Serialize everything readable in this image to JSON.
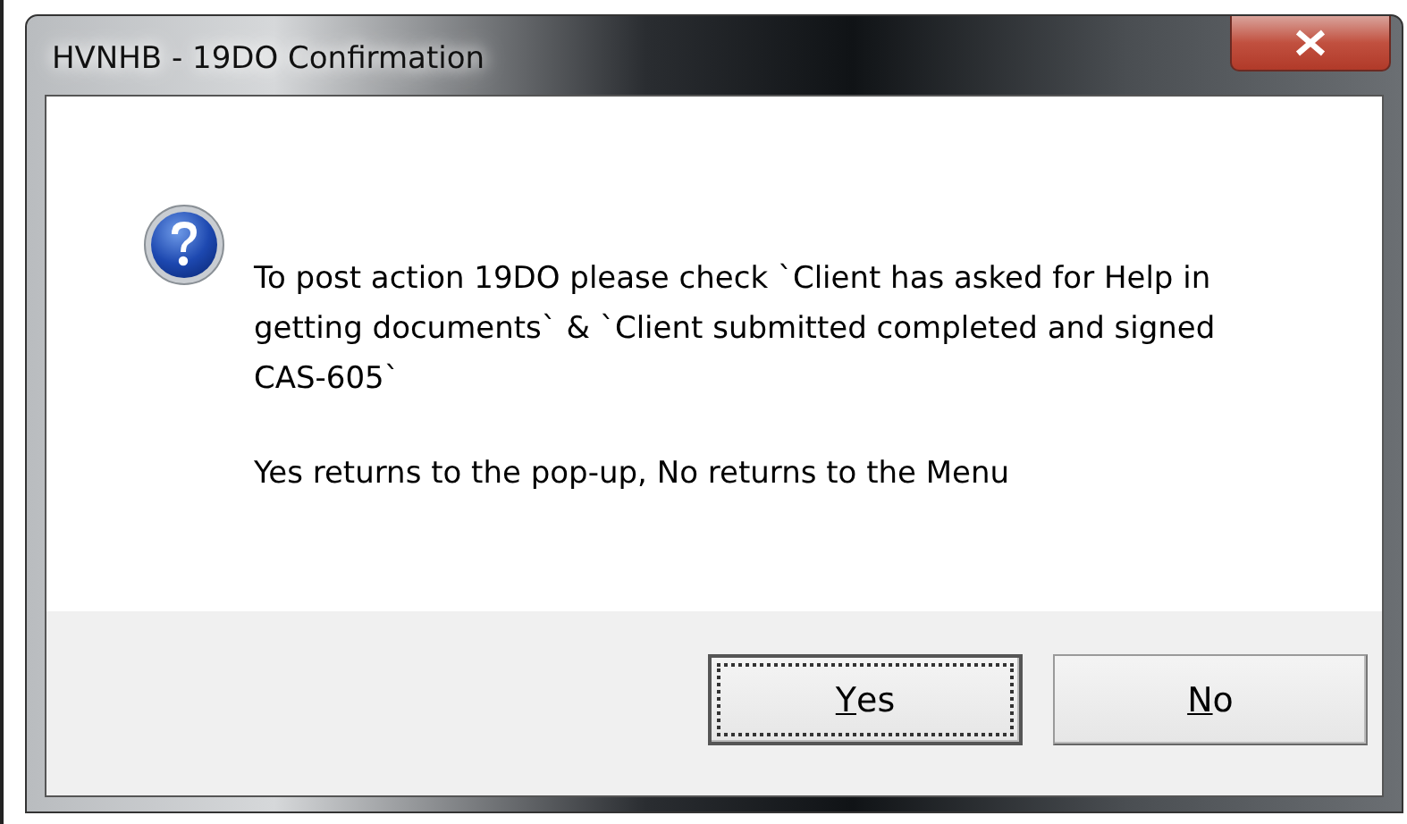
{
  "window": {
    "title": "HVNHB - 19DO Confirmation"
  },
  "message": {
    "paragraphs": [
      "To post action 19DO please check `Client has asked for Help in getting documents` & `Client submitted completed and signed CAS-605`",
      "Yes returns to the pop-up, No returns to the Menu"
    ]
  },
  "buttons": [
    {
      "label": "Yes",
      "mnemonic_underlined": true,
      "focused": true
    },
    {
      "label": "No",
      "mnemonic_underlined": true,
      "focused": false
    }
  ]
}
